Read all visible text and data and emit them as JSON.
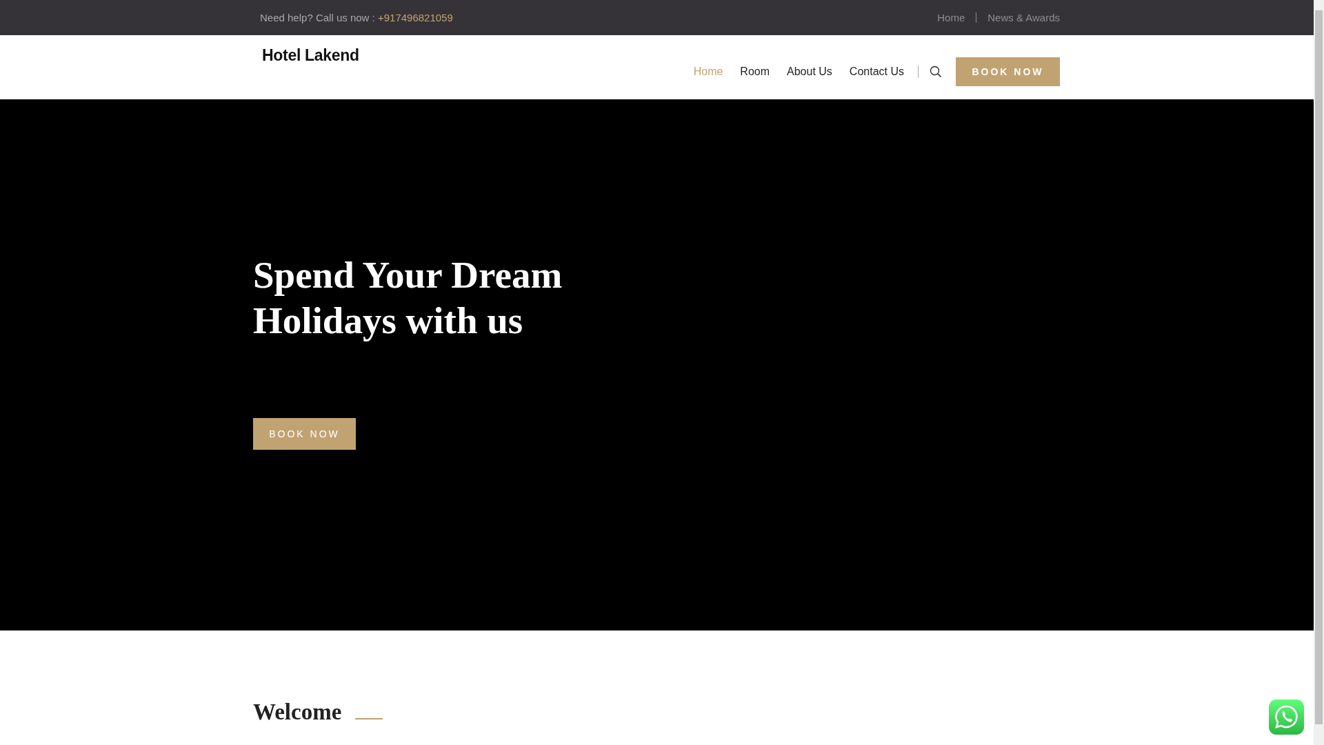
{
  "topbar": {
    "help_text": "Need help? Call us now :",
    "phone": "+917496821059",
    "links": [
      {
        "label": "Home"
      },
      {
        "label": "News & Awards"
      }
    ]
  },
  "header": {
    "logo": "Hotel Lakend",
    "nav": [
      {
        "label": "Home",
        "selected": true
      },
      {
        "label": "Room",
        "selected": false
      },
      {
        "label": "About Us",
        "selected": false
      },
      {
        "label": "Contact Us",
        "selected": false
      }
    ],
    "button": "BOOK NOW"
  },
  "hero": {
    "title": "Spend Your Dream Holidays with us",
    "button": "BOOK NOW"
  },
  "welcome": {
    "heading": "Welcome"
  }
}
